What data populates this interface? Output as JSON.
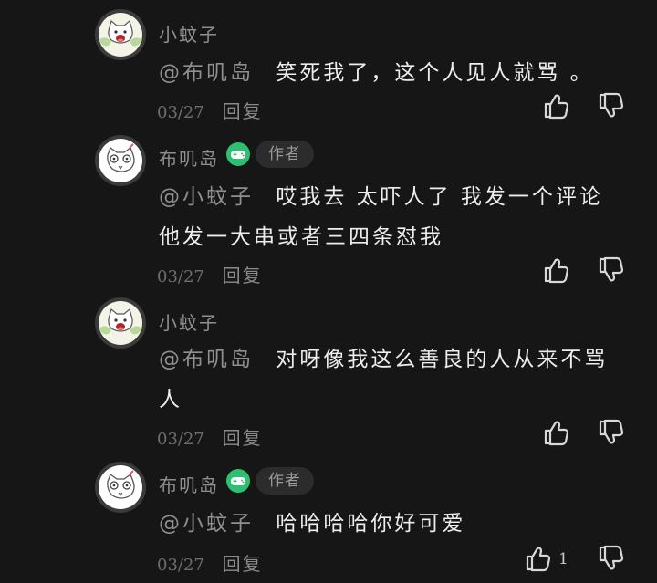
{
  "comments": [
    {
      "username": "小蚊子",
      "is_author": false,
      "mention": "@布叽岛",
      "text": "笑死我了，这个人见人就骂 。",
      "date": "03/27",
      "reply_label": "回复",
      "like_count": ""
    },
    {
      "username": "布叽岛",
      "is_author": true,
      "author_tag": "作者",
      "mention": "@小蚊子",
      "text_line1": "哎我去 太吓人了 我发一个评论",
      "text_line2": "他发一大串或者三四条怼我",
      "date": "03/27",
      "reply_label": "回复",
      "like_count": ""
    },
    {
      "username": "小蚊子",
      "is_author": false,
      "mention": "@布叽岛",
      "text_line1": "对呀像我这么善良的人从来不骂",
      "text_line2": "人",
      "date": "03/27",
      "reply_label": "回复",
      "like_count": ""
    },
    {
      "username": "布叽岛",
      "is_author": true,
      "author_tag": "作者",
      "mention": "@小蚊子",
      "text": "哈哈哈哈你好可爱",
      "date": "03/27",
      "reply_label": "回复",
      "like_count": "1"
    }
  ],
  "colors": {
    "background": "#161616",
    "badge_green": "#2fbf71"
  }
}
